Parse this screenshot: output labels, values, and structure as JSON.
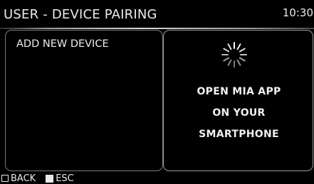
{
  "header": {
    "title": "USER - DEVICE PAIRING",
    "clock": "10:30"
  },
  "left_panel": {
    "items": [
      {
        "label": "ADD NEW DEVICE"
      }
    ]
  },
  "right_panel": {
    "spinner_icon": "loading-spinner-icon",
    "message_lines": [
      "OPEN MIA APP",
      "ON YOUR",
      "SMARTPHONE"
    ]
  },
  "footer": {
    "back_label": "BACK",
    "back_icon": "outline-square-icon",
    "esc_label": "ESC",
    "esc_icon": "filled-square-icon"
  }
}
